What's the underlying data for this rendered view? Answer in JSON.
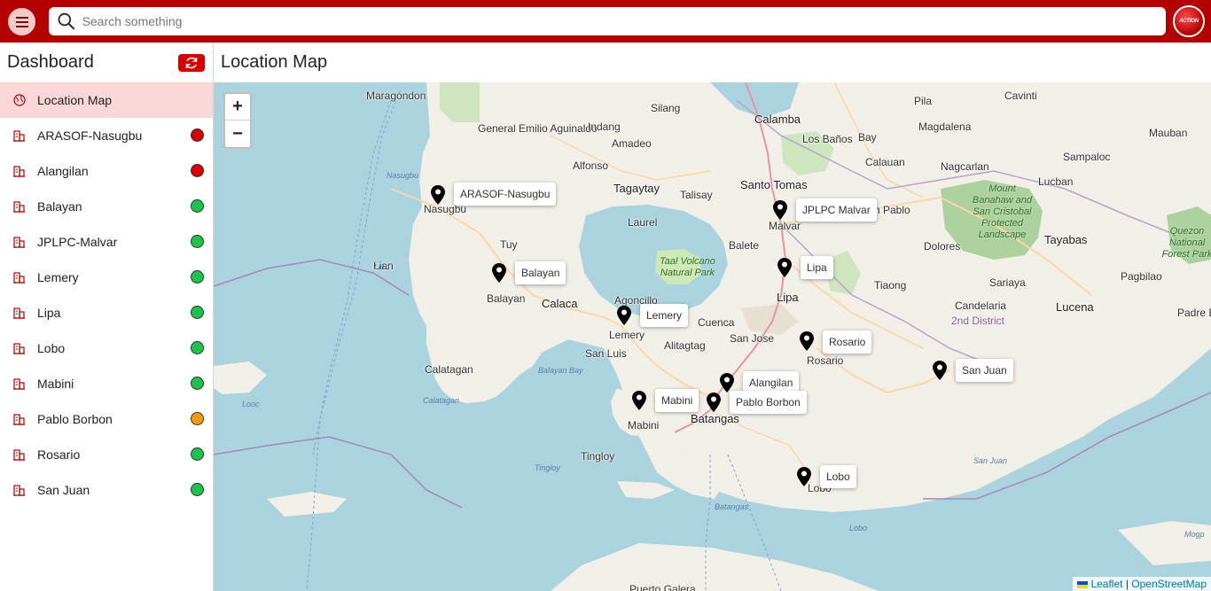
{
  "search": {
    "placeholder": "Search something"
  },
  "logo": {
    "text": "ACTION"
  },
  "sidebar": {
    "title": "Dashboard",
    "items": [
      {
        "label": "Location Map",
        "active": true,
        "status": null
      },
      {
        "label": "ARASOF-Nasugbu",
        "status": "#d40000"
      },
      {
        "label": "Alangilan",
        "status": "#d40000"
      },
      {
        "label": "Balayan",
        "status": "#1ec14b"
      },
      {
        "label": "JPLPC-Malvar",
        "status": "#1ec14b"
      },
      {
        "label": "Lemery",
        "status": "#1ec14b"
      },
      {
        "label": "Lipa",
        "status": "#1ec14b"
      },
      {
        "label": "Lobo",
        "status": "#1ec14b"
      },
      {
        "label": "Mabini",
        "status": "#1ec14b"
      },
      {
        "label": "Pablo Borbon",
        "status": "#f39c12"
      },
      {
        "label": "Rosario",
        "status": "#1ec14b"
      },
      {
        "label": "San Juan",
        "status": "#1ec14b"
      }
    ]
  },
  "main": {
    "title": "Location Map"
  },
  "map": {
    "zoom_in": "+",
    "zoom_out": "−",
    "markers": [
      "ARASOF-Nasugbu",
      "Balayan",
      "Lemery",
      "JPLPC Malvar",
      "Lipa",
      "Rosario",
      "Alangilan",
      "Pablo Borbon",
      "Mabini",
      "Lobo",
      "San Juan"
    ],
    "place_labels": [
      "Maragondon",
      "Silang",
      "Calamba",
      "Pila",
      "Cavinti",
      "General Emilio Aguinaldo",
      "Indang",
      "Amadeo",
      "Los Baños",
      "Bay",
      "Magdalena",
      "Mauban",
      "Alfonso",
      "Calauan",
      "Nagcarlan",
      "Sampaloc",
      "Tagaytay",
      "Talisay",
      "Santo Tomas",
      "Lucban",
      "Nasugbu",
      "Laurel",
      "Malvar",
      "n Pablo",
      "Dolores",
      "Tayabas",
      "Lian",
      "Tuy",
      "Balete",
      "Tiaong",
      "Sariaya",
      "Pagbilao",
      "Balayan",
      "Calaca",
      "Agoncillo",
      "Lipa",
      "Candelaria",
      "Lucena",
      "Padre B",
      "Lemery",
      "Cuenca",
      "San Jose",
      "Alitagtag",
      "Rosario",
      "San Luis",
      "Calatagan",
      "Batangas",
      "Mabini",
      "Tingloy",
      "Lobo",
      "Puerto Galera"
    ],
    "water_labels": [
      "Nasugbu",
      "Lian",
      "Balayan Bay",
      "Calatagan",
      "Looc",
      "Tingloy",
      "Batangas",
      "San Juan",
      "Lobo",
      "Mogp"
    ],
    "park_labels": [
      "Taal Volcano Natural Park",
      "Mount Banahaw and San Cristobal Protected Landscape",
      "Quezon National Forest Park"
    ],
    "district_label": "2nd District",
    "attribution": {
      "leaflet": "Leaflet",
      "sep": " | ",
      "osm": "OpenStreetMap"
    }
  }
}
